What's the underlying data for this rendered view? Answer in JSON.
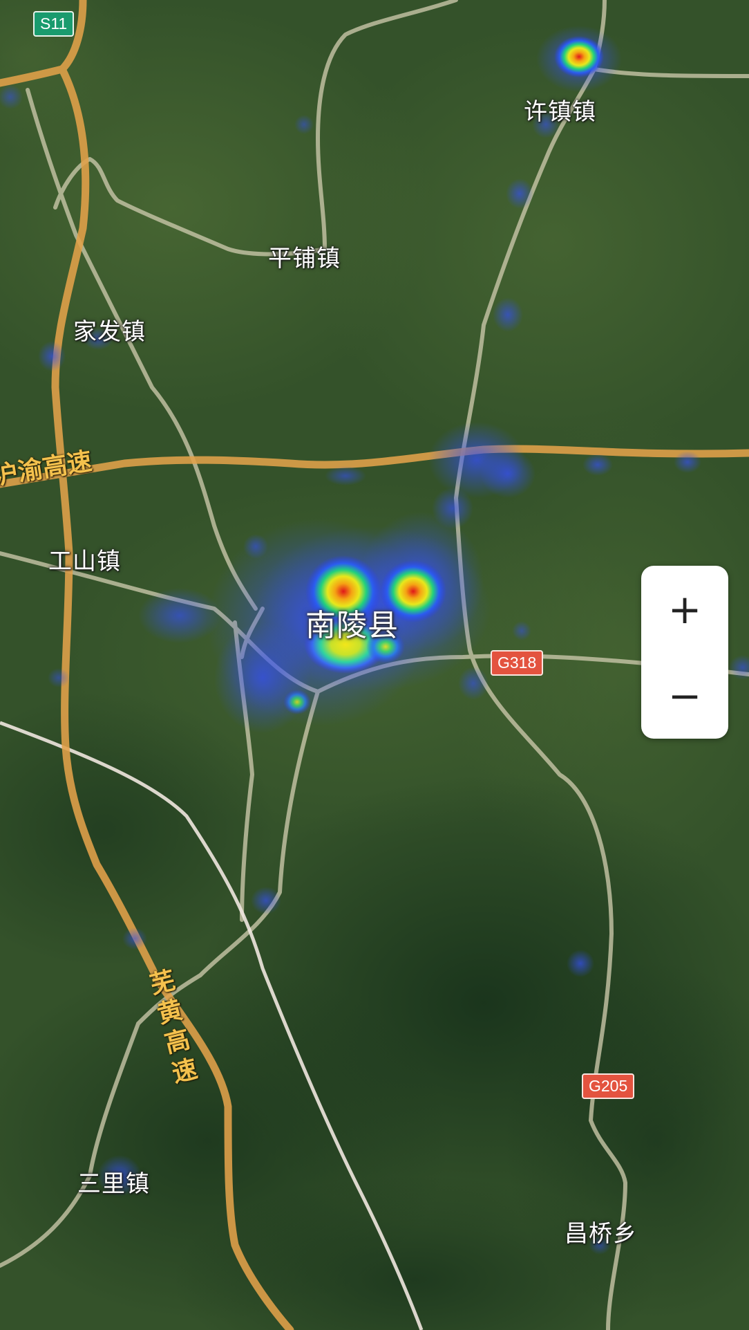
{
  "map": {
    "places": {
      "xuzhen": "许镇镇",
      "pingpu": "平铺镇",
      "jiafa": "家发镇",
      "gongshan": "工山镇",
      "county": "南陵县",
      "sanli": "三里镇",
      "changqiao": "昌桥乡"
    },
    "shields": {
      "s11": "S11",
      "g318": "G318",
      "g205": "G205"
    },
    "highways": {
      "huyu": "沪渝高速",
      "wuhuang": "芜黄高速"
    },
    "colors": {
      "expressway": "#e2a24a",
      "road": "#c8c6a8",
      "rail": "#efe7df",
      "terrain_dark": "#1f3a1a",
      "terrain_light": "#4a6a34"
    }
  },
  "zoom": {
    "in_label": "+",
    "out_label": "−"
  }
}
